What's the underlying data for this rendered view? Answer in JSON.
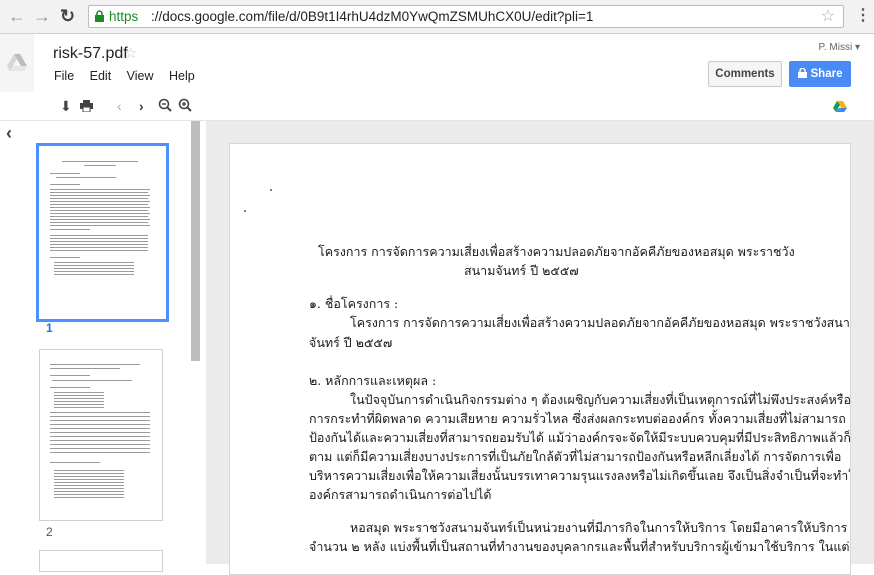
{
  "browser": {
    "url_https": "https",
    "url_rest": "://docs.google.com/file/d/0B9t1I4rhU4dzM0YwQmZSMUhCX0U/edit?pli=1",
    "icons": [
      "back-arrow",
      "forward-arrow",
      "reload",
      "lock",
      "bookmark-star",
      "chrome-menu"
    ]
  },
  "header": {
    "file_title": "risk-57.pdf",
    "user": "P. Missi ▾",
    "menu": [
      "File",
      "Edit",
      "View",
      "Help"
    ],
    "comments_label": "Comments",
    "share_label": "Share"
  },
  "toolbar": {
    "icons": [
      "download-icon",
      "print-icon",
      "prev-page-icon",
      "next-page-icon",
      "zoom-out-icon",
      "zoom-in-icon"
    ]
  },
  "thumbnails": {
    "pages": [
      "1",
      "2"
    ],
    "active_page": "1"
  },
  "document": {
    "title_line1": "โครงการ การจัดการความเสี่ยงเพื่อสร้างความปลอดภัยจากอัคคีภัยของหอสมุด พระราชวัง",
    "title_line2": "สนามจันทร์ ปี ๒๕๕๗",
    "s1_heading": "๑. ชื่อโครงการ :",
    "s1_line1": "โครงการ การจัดการความเสี่ยงเพื่อสร้างความปลอดภัยจากอัคคีภัยของหอสมุด พระราชวังสนาม",
    "s1_line2": "จันทร์  ปี ๒๕๕๗",
    "s2_heading": "๒. หลักการและเหตุผล  :",
    "p1": [
      "ในปัจจุบันการดำเนินกิจกรรมต่าง ๆ ต้องเผชิญกับความเสี่ยงที่เป็นเหตุการณ์ที่ไม่พึงประสงค์หรือ",
      "การกระทำที่ผิดพลาด ความเสียหาย ความรั่วไหล ซึ่งส่งผลกระทบต่อองค์กร ทั้งความเสี่ยงที่ไม่สามารถ",
      "ป้องกันได้และความเสี่ยงที่สามารถยอมรับได้ แม้ว่าองค์กรจะจัดให้มีระบบควบคุมที่มีประสิทธิภาพแล้วก็",
      "ตาม  แต่ก็มีความเสี่ยงบางประการที่เป็นภัยใกล้ตัวที่ไม่สามารถป้องกันหรือหลีกเลี่ยงได้ การจัดการเพื่อ",
      "บริหารความเสี่ยงเพื่อให้ความเสี่ยงนั้นบรรเทาความรุนแรงลงหรือไม่เกิดขึ้นเลย จึงเป็นสิ่งจำเป็นที่จะทำให้",
      "องค์กรสามารถดำเนินการต่อไปได้"
    ],
    "p2": [
      "หอสมุด พระราชวังสนามจันทร์เป็นหน่วยงานที่มีภารกิจในการให้บริการ โดยมีอาคารให้บริการ",
      "จำนวน ๒ หลัง แบ่งพื้นที่เป็นสถานที่ทำงานของบุคลากรและพื้นที่สำหรับบริการผู้เข้ามาใช้บริการ ในแต่"
    ]
  }
}
